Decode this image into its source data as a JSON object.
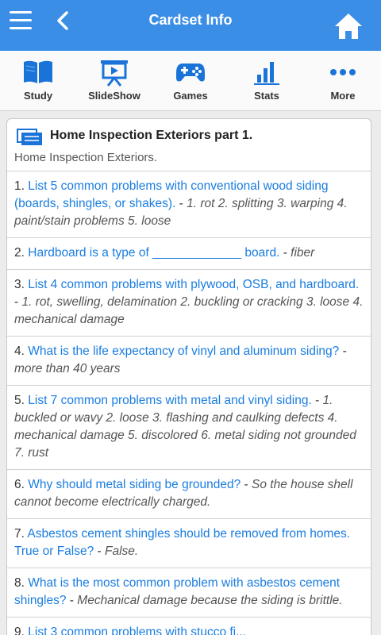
{
  "header": {
    "title": "Cardset Info",
    "menu_icon": "hamburger-icon",
    "back_icon": "chevron-left-icon",
    "home_icon": "home-icon",
    "color": "#3a8ee6"
  },
  "tabs": [
    {
      "label": "Study",
      "icon": "book-icon"
    },
    {
      "label": "SlideShow",
      "icon": "presentation-icon"
    },
    {
      "label": "Games",
      "icon": "gamepad-icon"
    },
    {
      "label": "Stats",
      "icon": "bar-chart-icon"
    },
    {
      "label": "More",
      "icon": "more-dots-icon"
    }
  ],
  "cardset": {
    "title": "Home Inspection Exteriors part 1.",
    "subtitle": "Home Inspection Exteriors.",
    "items": [
      {
        "num": "1.",
        "q": "List 5 common problems with conventional wood siding (boards, shingles, or shakes).",
        "a": "1. rot 2. splitting 3. warping 4. paint/stain problems 5. loose"
      },
      {
        "num": "2.",
        "q": "Hardboard is a type of _____________ board.",
        "a": "fiber"
      },
      {
        "num": "3.",
        "q": "List 4 common problems with plywood, OSB, and hardboard.",
        "a": "1. rot, swelling, delamination 2. buckling or cracking 3. loose 4. mechanical damage"
      },
      {
        "num": "4.",
        "q": "What is the life expectancy of vinyl and aluminum siding?",
        "a": "more than 40 years"
      },
      {
        "num": "5.",
        "q": "List 7 common problems with metal and vinyl siding.",
        "a": "1. buckled or wavy 2. loose 3. flashing and caulking defects 4. mechanical damage 5. discolored 6. metal siding not grounded 7. rust"
      },
      {
        "num": "6.",
        "q": "Why should metal siding be grounded?",
        "a": "So the house shell cannot become electrically charged."
      },
      {
        "num": "7.",
        "q": "Asbestos cement shingles should be removed from homes. True or False?",
        "a": "False."
      },
      {
        "num": "8.",
        "q": "What is the most common problem with asbestos cement shingles?",
        "a": "Mechanical damage because the siding is brittle."
      },
      {
        "num": "9.",
        "q": "List 3 common problems with stucco fi...",
        "a": ""
      }
    ]
  }
}
